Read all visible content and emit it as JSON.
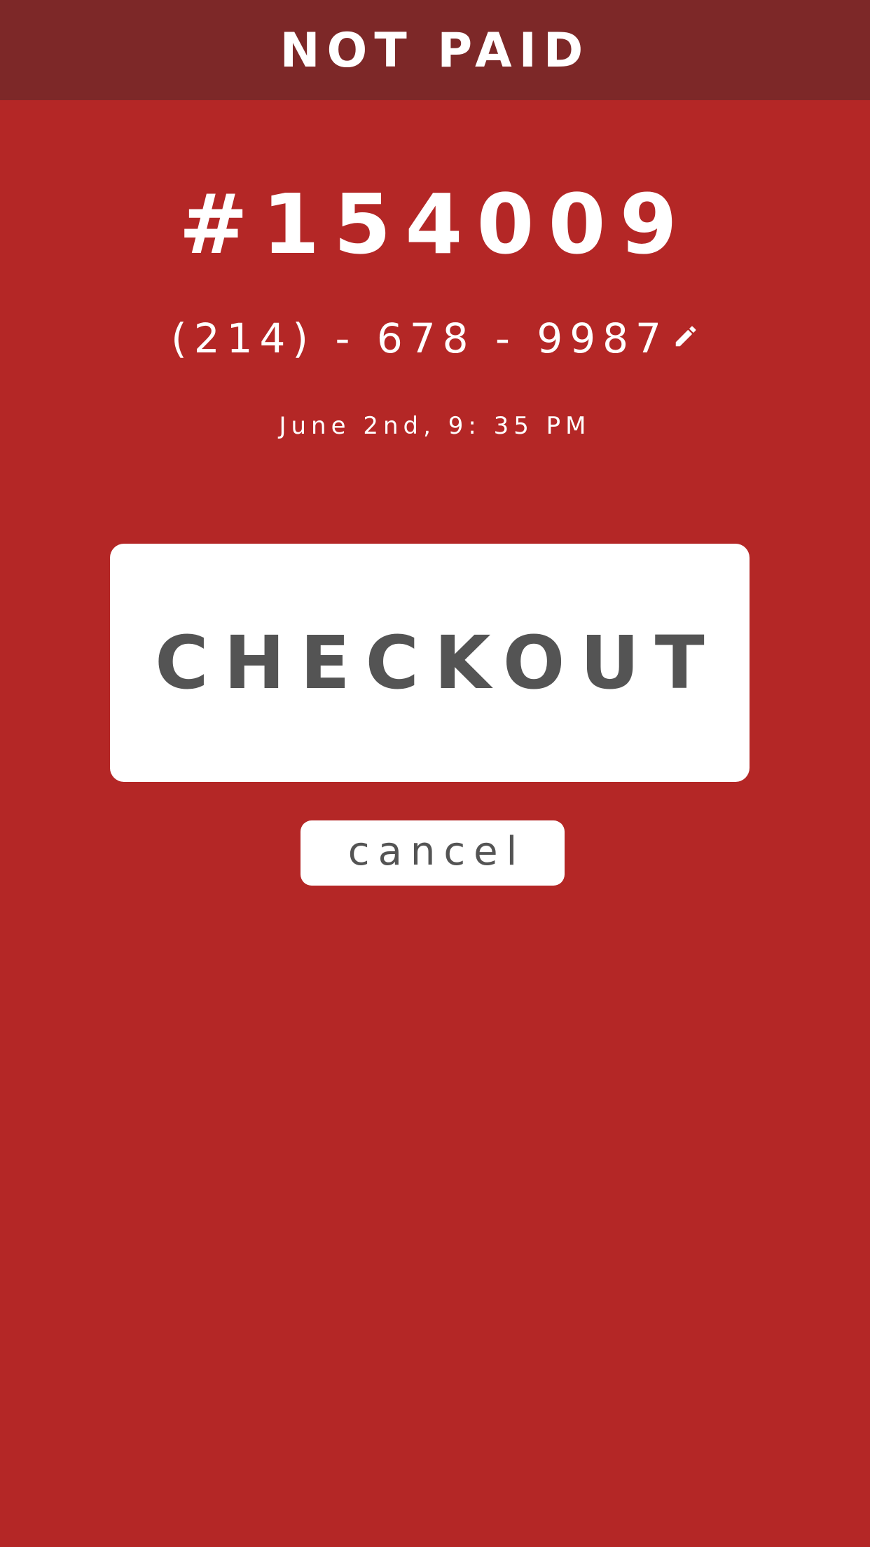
{
  "header": {
    "status": "NOT PAID",
    "background_color": "#7d2828"
  },
  "order": {
    "number": "#154009",
    "phone": "(214) - 678 - 9987",
    "edit_icon": "pencil-icon",
    "datetime": "June 2nd, 9: 35 PM"
  },
  "actions": {
    "checkout_label": "CHECKOUT",
    "cancel_label": "cancel"
  },
  "colors": {
    "background": "#b42726",
    "button_text": "#545454",
    "button_background": "#ffffff"
  }
}
